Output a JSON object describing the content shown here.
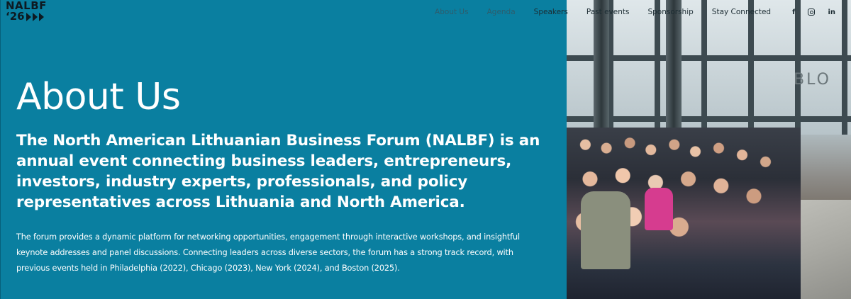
{
  "logo": {
    "line1": "NALBF",
    "line2": "‘26"
  },
  "nav": {
    "items": [
      {
        "label": "About Us"
      },
      {
        "label": "Agenda"
      },
      {
        "label": "Speakers"
      },
      {
        "label": "Past events"
      },
      {
        "label": "Sponsorship"
      },
      {
        "label": "Stay Connected"
      }
    ],
    "social": {
      "facebook": "f",
      "linkedin": "in"
    }
  },
  "main": {
    "heading": "About Us",
    "lead": "The North American Lithuanian Business Forum (NALBF) is an annual event connecting business leaders, entrepreneurs, investors, industry experts, professionals, and policy representatives across Lithuania and North America.",
    "body": "The forum provides a dynamic platform for networking opportunities, engagement through interactive workshops, and insightful keynote addresses and panel discussions. Connecting leaders across diverse sectors, the forum has a strong track record, with previous events held in Philadelphia (2022), Chicago (2023), New York (2024), and Boston (2025)."
  },
  "photo": {
    "sign_text": "BLO"
  },
  "colors": {
    "panel": "#0a7fa0",
    "text": "#ffffff",
    "nav_text": "#1c2c33"
  }
}
